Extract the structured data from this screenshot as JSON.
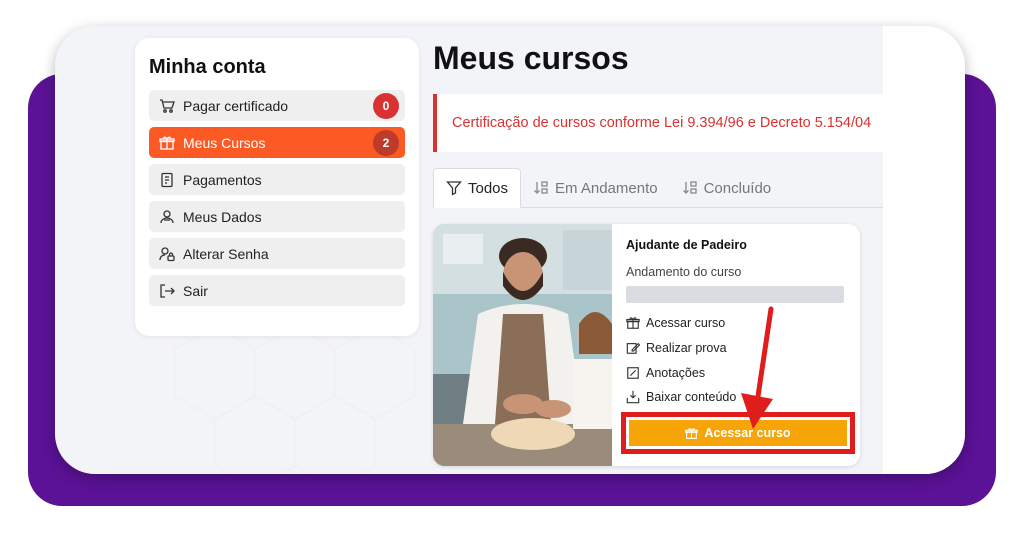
{
  "sidebar": {
    "title": "Minha conta",
    "items": [
      {
        "label": "Pagar certificado",
        "icon": "cart-icon",
        "badge": "0"
      },
      {
        "label": "Meus Cursos",
        "icon": "gift-icon",
        "badge": "2",
        "active": true
      },
      {
        "label": "Pagamentos",
        "icon": "receipt-icon"
      },
      {
        "label": "Meus Dados",
        "icon": "user-card-icon"
      },
      {
        "label": "Alterar Senha",
        "icon": "user-lock-icon"
      },
      {
        "label": "Sair",
        "icon": "logout-icon"
      }
    ]
  },
  "main": {
    "title": "Meus cursos",
    "alert": "Certificação de cursos conforme Lei 9.394/96 e Decreto 5.154/04",
    "tabs": [
      {
        "label": "Todos",
        "icon": "filter-icon",
        "active": true
      },
      {
        "label": "Em Andamento",
        "icon": "sort-down-icon"
      },
      {
        "label": "Concluído",
        "icon": "sort-down-icon"
      }
    ],
    "course": {
      "name": "Ajudante de Padeiro",
      "progress_label": "Andamento do curso",
      "progress": 0,
      "links": [
        {
          "label": "Acessar curso",
          "icon": "gift-icon"
        },
        {
          "label": "Realizar prova",
          "icon": "edit-icon"
        },
        {
          "label": "Anotações",
          "icon": "note-icon"
        },
        {
          "label": "Baixar conteúdo",
          "icon": "download-icon"
        }
      ],
      "button_label": "Acessar curso",
      "image_alt": "Padeiro sorrindo sovando massa de pão com uma criança ao lado"
    }
  },
  "colors": {
    "accent": "#fb5a24",
    "badge": "#d83232",
    "button": "#f7a408",
    "purple": "#5b1296",
    "highlight": "#e01d1d"
  }
}
